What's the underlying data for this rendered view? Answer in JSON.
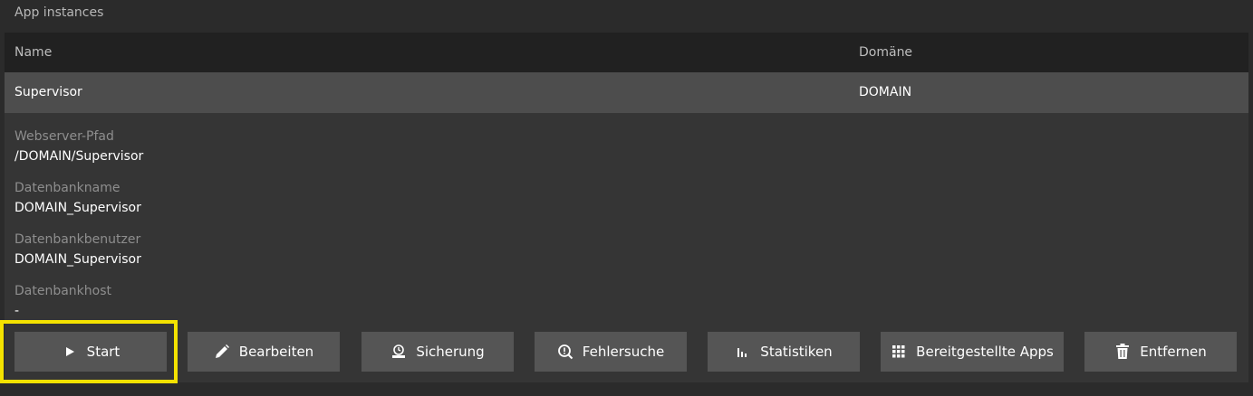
{
  "section_title": "App instances",
  "table": {
    "columns": [
      "Name",
      "Domäne"
    ],
    "row": {
      "name": "Supervisor",
      "domain": "DOMAIN"
    }
  },
  "details": [
    {
      "label": "Webserver-Pfad",
      "value": "/DOMAIN/Supervisor"
    },
    {
      "label": "Datenbankname",
      "value": "DOMAIN_Supervisor"
    },
    {
      "label": "Datenbankbenutzer",
      "value": "DOMAIN_Supervisor"
    },
    {
      "label": "Datenbankhost",
      "value": "-"
    }
  ],
  "actions": {
    "start": {
      "label": "Start",
      "icon": "play-icon"
    },
    "edit": {
      "label": "Bearbeiten",
      "icon": "pencil-icon"
    },
    "backup": {
      "label": "Sicherung",
      "icon": "backup-icon"
    },
    "debug": {
      "label": "Fehlersuche",
      "icon": "search-icon"
    },
    "stats": {
      "label": "Statistiken",
      "icon": "bar-chart-icon"
    },
    "apps": {
      "label": "Bereitgestellte Apps",
      "icon": "grid-icon"
    },
    "remove": {
      "label": "Entfernen",
      "icon": "trash-icon"
    }
  },
  "colors": {
    "highlight": "#f4e200",
    "button": "#555555",
    "row_selected": "#4d4d4d"
  }
}
